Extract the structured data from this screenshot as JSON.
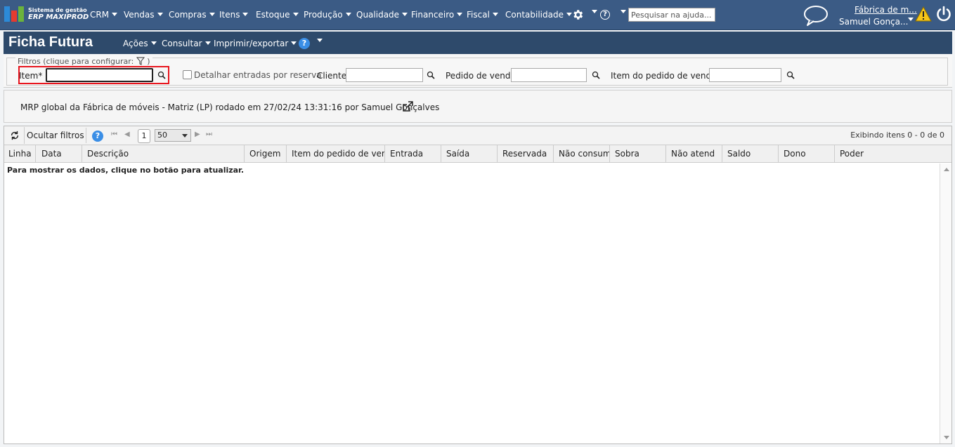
{
  "brand": {
    "line1": "Sistema de gestão",
    "line2": "ERP MAXIPROD"
  },
  "nav": {
    "menus": [
      "CRM",
      "Vendas",
      "Compras",
      "Itens",
      "Estoque",
      "Produção",
      "Qualidade",
      "Financeiro",
      "Fiscal",
      "Contabilidade"
    ],
    "help_placeholder": "Pesquisar na ajuda...",
    "company": "Fábrica de m...",
    "user": "Samuel Gonça..."
  },
  "header": {
    "title": "Ficha Futura",
    "menus": [
      "Ações",
      "Consultar",
      "Imprimir/exportar"
    ],
    "help_glyph": "?"
  },
  "filters": {
    "legend": "Filtros (clique para configurar:",
    "legend_close": ")",
    "item_label": "Item*",
    "item_value": "",
    "reserve_label": "Detalhar entradas por reserva",
    "client_label": "Cliente",
    "order_label": "Pedido de venda",
    "order_item_label": "Item do pedido de venda"
  },
  "info": {
    "mrp_text": "MRP global da Fábrica de móveis - Matriz (LP) rodado em 27/02/24 13:31:16 por Samuel Gonçalves"
  },
  "grid": {
    "hide_filters": "Ocultar filtros",
    "page": "1",
    "page_size": "50",
    "count_text": "Exibindo itens 0 - 0 de 0",
    "columns": [
      "Linha",
      "Data",
      "Descrição",
      "Origem",
      "Item do pedido de venda",
      "Entrada",
      "Saída",
      "Reservada",
      "Não consum",
      "Sobra",
      "Não atend",
      "Saldo",
      "Dono",
      "Poder"
    ],
    "empty_message": "Para mostrar os dados, clique no botão para atualizar."
  },
  "colors": {
    "topbar": "#3b5b85",
    "header": "#2e4a6b",
    "highlight": "#e8151e",
    "help_blue": "#3a8ee6"
  }
}
